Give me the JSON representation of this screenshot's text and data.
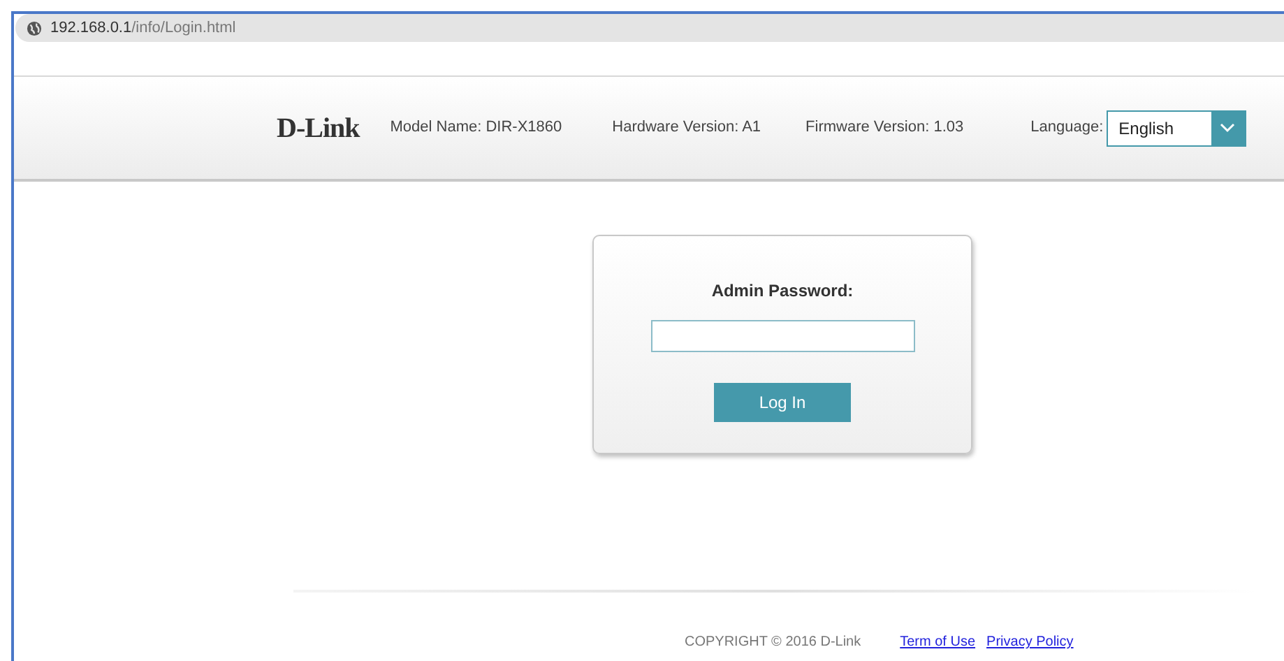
{
  "address_bar": {
    "host": "192.168.0.1",
    "path": "/info/Login.html"
  },
  "header": {
    "logo": "D-Link",
    "model": "Model Name: DIR-X1860",
    "hardware": "Hardware Version: A1",
    "firmware": "Firmware Version: 1.03",
    "language_label": "Language:",
    "language_value": "English"
  },
  "login": {
    "label": "Admin Password:",
    "button": "Log In"
  },
  "footer": {
    "copyright": "COPYRIGHT © 2016 D-Link",
    "links": [
      "Term of Use",
      "Privacy Policy"
    ]
  }
}
